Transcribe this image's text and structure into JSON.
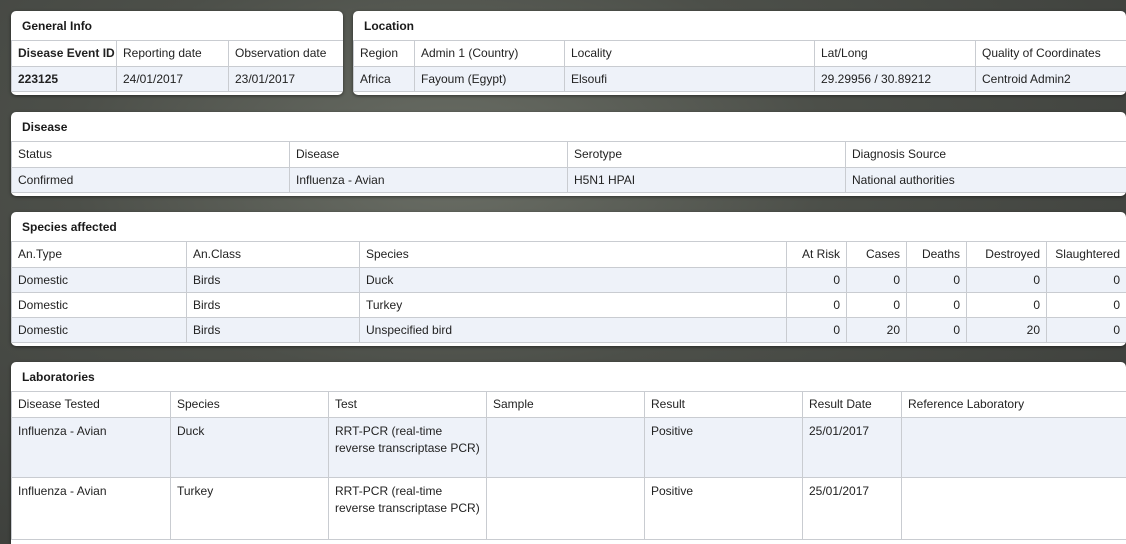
{
  "general": {
    "title": "General Info",
    "headers": [
      "Disease Event ID",
      "Reporting date",
      "Observation date"
    ],
    "values": [
      "223125",
      "24/01/2017",
      "23/01/2017"
    ]
  },
  "location": {
    "title": "Location",
    "headers": [
      "Region",
      "Admin 1 (Country)",
      "Locality",
      "Lat/Long",
      "Quality of Coordinates"
    ],
    "values": [
      "Africa",
      "Fayoum (Egypt)",
      "Elsoufi",
      "29.29956 / 30.89212",
      "Centroid Admin2"
    ]
  },
  "disease": {
    "title": "Disease",
    "headers": [
      "Status",
      "Disease",
      "Serotype",
      "Diagnosis Source"
    ],
    "values": [
      "Confirmed",
      "Influenza - Avian",
      "H5N1 HPAI",
      "National authorities"
    ]
  },
  "species": {
    "title": "Species affected",
    "headers": [
      "An.Type",
      "An.Class",
      "Species",
      "At Risk",
      "Cases",
      "Deaths",
      "Destroyed",
      "Slaughtered"
    ],
    "rows": [
      [
        "Domestic",
        "Birds",
        "Duck",
        "0",
        "0",
        "0",
        "0",
        "0"
      ],
      [
        "Domestic",
        "Birds",
        "Turkey",
        "0",
        "0",
        "0",
        "0",
        "0"
      ],
      [
        "Domestic",
        "Birds",
        "Unspecified bird",
        "0",
        "20",
        "0",
        "20",
        "0"
      ]
    ]
  },
  "labs": {
    "title": "Laboratories",
    "headers": [
      "Disease Tested",
      "Species",
      "Test",
      "Sample",
      "Result",
      "Result Date",
      "Reference Laboratory"
    ],
    "rows": [
      [
        "Influenza - Avian",
        "Duck",
        "RRT-PCR (real-time reverse transcriptase PCR)",
        "",
        "Positive",
        "25/01/2017",
        ""
      ],
      [
        "Influenza - Avian",
        "Turkey",
        "RRT-PCR (real-time reverse transcriptase PCR)",
        "",
        "Positive",
        "25/01/2017",
        ""
      ]
    ]
  }
}
